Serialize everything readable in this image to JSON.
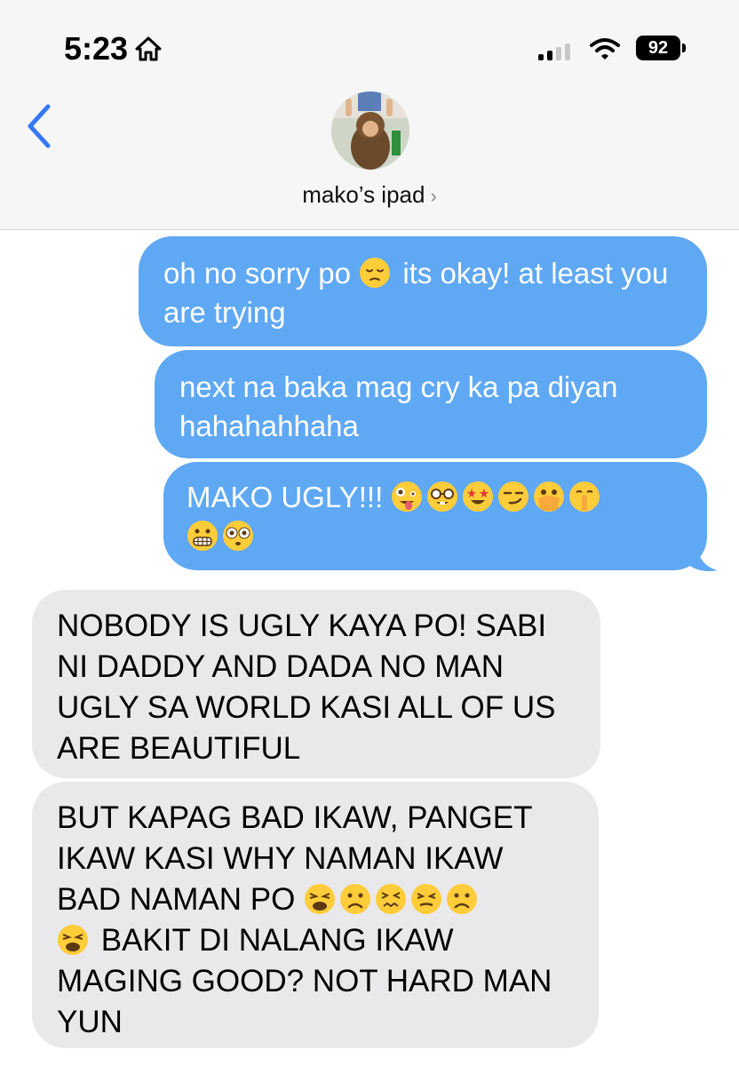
{
  "status_bar": {
    "time": "5:23",
    "battery": "92"
  },
  "header": {
    "contact_name": "mako’s ipad",
    "chevron": "›"
  },
  "messages": [
    {
      "direction": "sent",
      "text_a": "oh no sorry po",
      "emoji": "pensive-face-emoji",
      "text_b": "its okay! at least you are trying"
    },
    {
      "direction": "sent",
      "text": "next na baka mag cry ka pa diyan hahahahhaha"
    },
    {
      "direction": "sent",
      "text": "MAKO UGLY!!!",
      "emojis": [
        "zany-face-emoji",
        "nerd-face-emoji",
        "star-struck-emoji",
        "smirking-face-emoji",
        "face-with-open-eyes-hand-over-mouth-emoji",
        "shushing-face-emoji",
        "grimacing-face-emoji",
        "flushed-face-emoji"
      ]
    },
    {
      "direction": "received",
      "text": "NOBODY IS UGLY KAYA PO! SABI NI DADDY AND DADA NO MAN UGLY SA WORLD KASI ALL OF US ARE BEAUTIFUL"
    },
    {
      "direction": "received",
      "text_a": "BUT KAPAG BAD IKAW, PANGET IKAW KASI WHY NAMAN IKAW BAD NAMAN PO",
      "emojis": [
        "weary-face-emoji",
        "frowning-face-emoji",
        "confounded-face-emoji",
        "persevering-face-emoji",
        "frowning-face-emoji",
        "weary-face-emoji"
      ],
      "text_b": "BAKIT DI NALANG IKAW MAGING GOOD? NOT HARD MAN YUN"
    }
  ],
  "colors": {
    "sent_bubble": "#5fa8f4",
    "received_bubble": "#e9e9eb",
    "accent": "#3478f6"
  }
}
